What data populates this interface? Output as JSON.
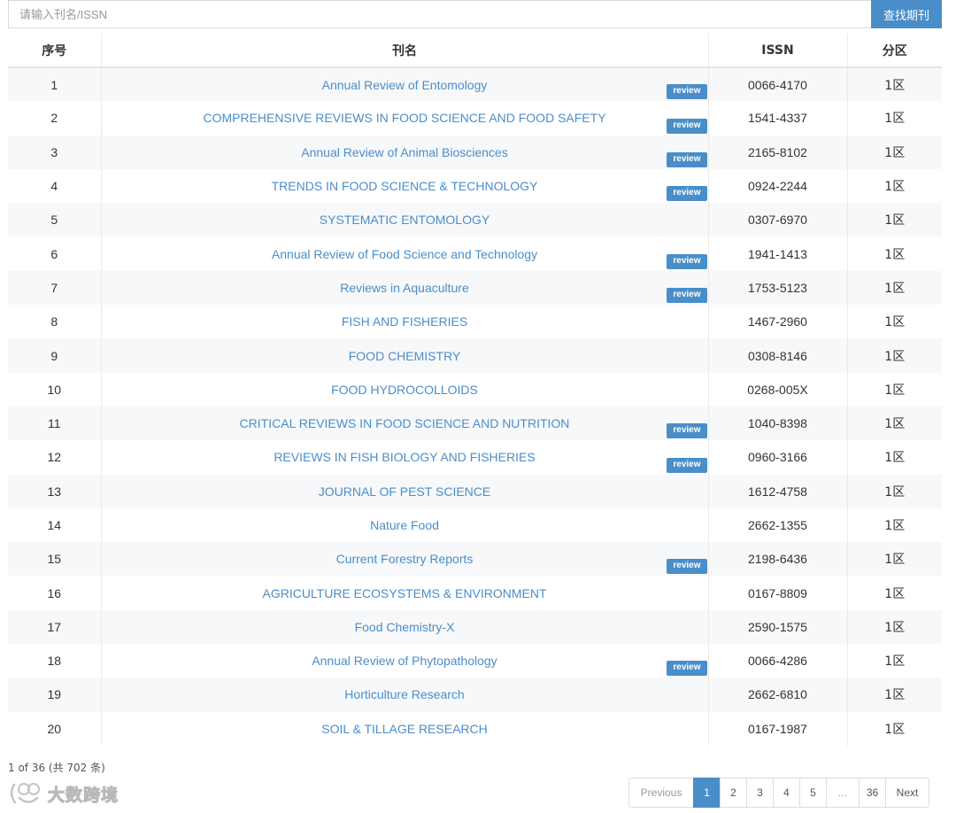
{
  "search": {
    "placeholder": "请输入刊名/ISSN",
    "button_label": "查找期刊"
  },
  "table": {
    "headers": [
      "序号",
      "刊名",
      "ISSN",
      "分区"
    ],
    "badge_label": "review",
    "rows": [
      {
        "no": "1",
        "name": "Annual Review of Entomology",
        "issn": "0066-4170",
        "zone": "1区",
        "review": true
      },
      {
        "no": "2",
        "name": "COMPREHENSIVE REVIEWS IN FOOD SCIENCE AND FOOD SAFETY",
        "issn": "1541-4337",
        "zone": "1区",
        "review": true
      },
      {
        "no": "3",
        "name": "Annual Review of Animal Biosciences",
        "issn": "2165-8102",
        "zone": "1区",
        "review": true
      },
      {
        "no": "4",
        "name": "TRENDS IN FOOD SCIENCE & TECHNOLOGY",
        "issn": "0924-2244",
        "zone": "1区",
        "review": true
      },
      {
        "no": "5",
        "name": "SYSTEMATIC ENTOMOLOGY",
        "issn": "0307-6970",
        "zone": "1区",
        "review": false
      },
      {
        "no": "6",
        "name": "Annual Review of Food Science and Technology",
        "issn": "1941-1413",
        "zone": "1区",
        "review": true
      },
      {
        "no": "7",
        "name": "Reviews in Aquaculture",
        "issn": "1753-5123",
        "zone": "1区",
        "review": true
      },
      {
        "no": "8",
        "name": "FISH AND FISHERIES",
        "issn": "1467-2960",
        "zone": "1区",
        "review": false
      },
      {
        "no": "9",
        "name": "FOOD CHEMISTRY",
        "issn": "0308-8146",
        "zone": "1区",
        "review": false
      },
      {
        "no": "10",
        "name": "FOOD HYDROCOLLOIDS",
        "issn": "0268-005X",
        "zone": "1区",
        "review": false
      },
      {
        "no": "11",
        "name": "CRITICAL REVIEWS IN FOOD SCIENCE AND NUTRITION",
        "issn": "1040-8398",
        "zone": "1区",
        "review": true
      },
      {
        "no": "12",
        "name": "REVIEWS IN FISH BIOLOGY AND FISHERIES",
        "issn": "0960-3166",
        "zone": "1区",
        "review": true
      },
      {
        "no": "13",
        "name": "JOURNAL OF PEST SCIENCE",
        "issn": "1612-4758",
        "zone": "1区",
        "review": false
      },
      {
        "no": "14",
        "name": "Nature Food",
        "issn": "2662-1355",
        "zone": "1区",
        "review": false
      },
      {
        "no": "15",
        "name": "Current Forestry Reports",
        "issn": "2198-6436",
        "zone": "1区",
        "review": true
      },
      {
        "no": "16",
        "name": "AGRICULTURE ECOSYSTEMS & ENVIRONMENT",
        "issn": "0167-8809",
        "zone": "1区",
        "review": false
      },
      {
        "no": "17",
        "name": "Food Chemistry-X",
        "issn": "2590-1575",
        "zone": "1区",
        "review": false
      },
      {
        "no": "18",
        "name": "Annual Review of Phytopathology",
        "issn": "0066-4286",
        "zone": "1区",
        "review": true
      },
      {
        "no": "19",
        "name": "Horticulture Research",
        "issn": "2662-6810",
        "zone": "1区",
        "review": false
      },
      {
        "no": "20",
        "name": "SOIL & TILLAGE RESEARCH",
        "issn": "0167-1987",
        "zone": "1区",
        "review": false
      }
    ]
  },
  "page_info": "1 of 36 (共 702 条)",
  "watermark": {
    "text": "大数跨境"
  },
  "pagination": {
    "previous_label": "Previous",
    "pages": [
      "1",
      "2",
      "3",
      "4",
      "5",
      "…",
      "36"
    ],
    "active_page": "1",
    "next_label": "Next"
  },
  "colors": {
    "accent": "#4a8ec9",
    "row_alt": "#f7f8fa"
  }
}
